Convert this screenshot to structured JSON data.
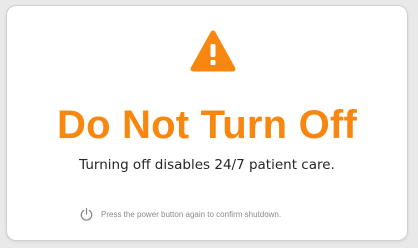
{
  "dialog": {
    "icon": "warning-triangle-icon",
    "headline": "Do Not Turn Off",
    "subtext": "Turning off disables 24/7 patient care.",
    "hint": {
      "icon": "power-icon",
      "text": "Press the power button again to confirm shutdown."
    }
  },
  "colors": {
    "accent": "#f7870f",
    "background": "#ffffff",
    "body_text": "#262626",
    "hint_text": "#8a8a8a"
  }
}
